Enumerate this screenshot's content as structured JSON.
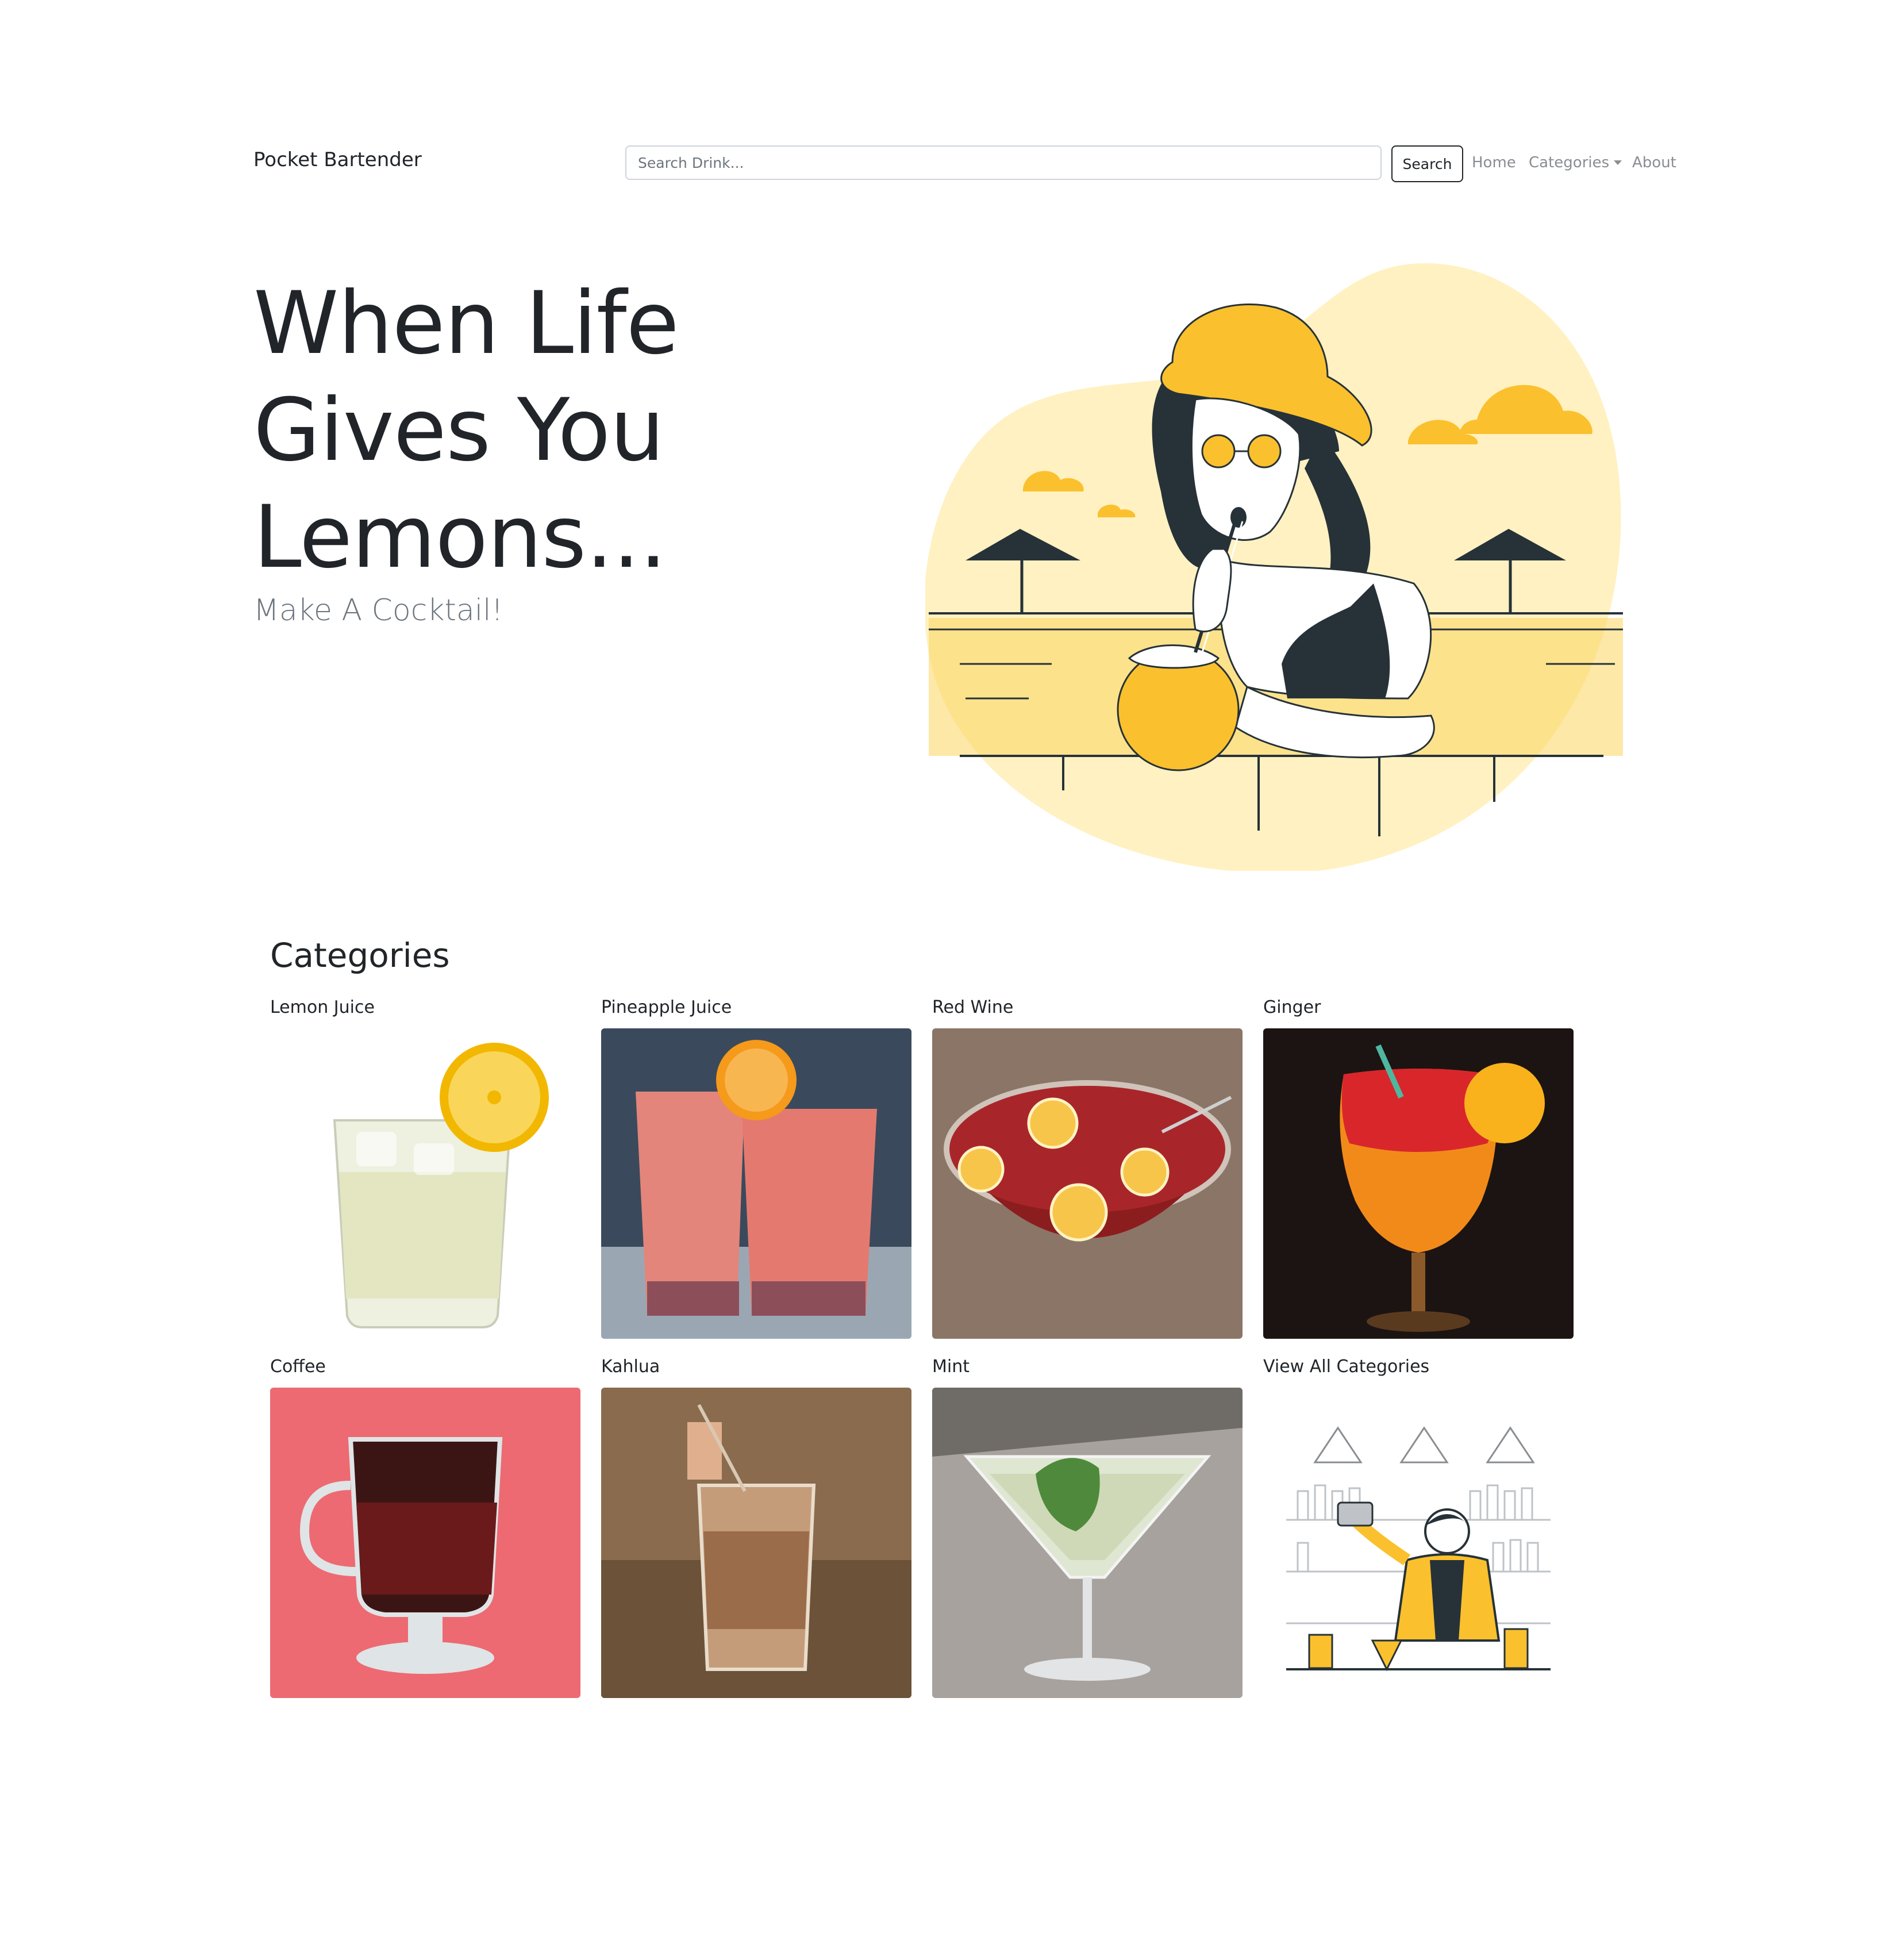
{
  "navbar": {
    "brand": "Pocket Bartender",
    "search_placeholder": "Search Drink...",
    "search_button": "Search",
    "links": {
      "home": "Home",
      "categories": "Categories",
      "about": "About"
    }
  },
  "hero": {
    "title_line1": "When Life",
    "title_line2": "Gives You",
    "title_line3": "Lemons...",
    "subtitle": "Make A Cocktail!",
    "illustration_icon": "woman-drinking-cocktail-illustration"
  },
  "categories": {
    "heading": "Categories",
    "items": [
      {
        "label": "Lemon Juice",
        "image": "lemon-juice-glass"
      },
      {
        "label": "Pineapple Juice",
        "image": "pineapple-juice-glasses"
      },
      {
        "label": "Red Wine",
        "image": "red-wine-punch-bowl"
      },
      {
        "label": "Ginger",
        "image": "ginger-cocktail"
      },
      {
        "label": "Coffee",
        "image": "coffee-mug"
      },
      {
        "label": "Kahlua",
        "image": "kahlua-shot"
      },
      {
        "label": "Mint",
        "image": "mint-martini"
      },
      {
        "label": "View All Categories",
        "image": "bartender-illustration"
      }
    ]
  },
  "colors": {
    "accent_yellow": "#FBC02D",
    "light_yellow": "#FFF1C1",
    "text_dark": "#212529",
    "text_muted": "#6c757d"
  }
}
